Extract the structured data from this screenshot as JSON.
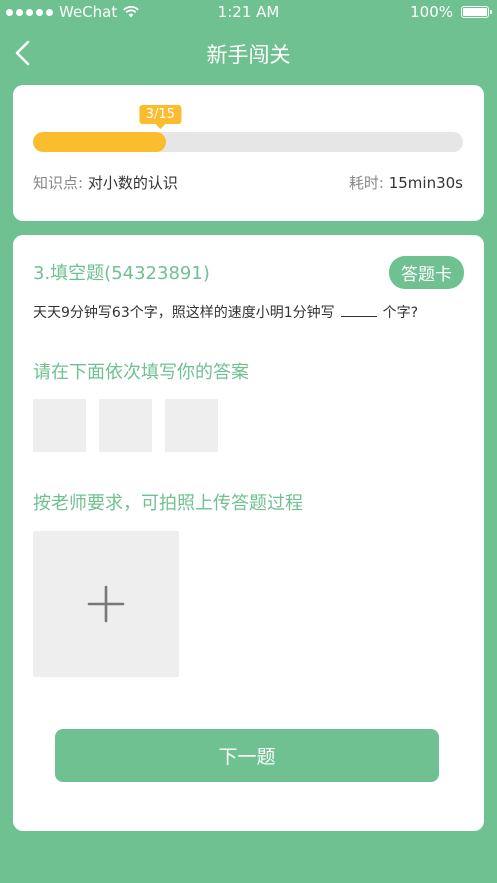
{
  "status_bar": {
    "carrier": "WeChat",
    "time": "1:21 AM",
    "battery": "100%"
  },
  "nav": {
    "title": "新手闯关"
  },
  "progress": {
    "badge": "3/15",
    "current": 3,
    "total": 15,
    "fill_percent": 31
  },
  "knowledge": {
    "label": "知识点:",
    "value": "对小数的认识"
  },
  "time_spent": {
    "label": "耗时:",
    "value": "15min30s"
  },
  "question": {
    "title": "3.填空题(54323891)",
    "answer_card_label": "答题卡",
    "text_before": "天天9分钟写63个字，照这样的速度小明1分钟写",
    "text_after": "个字?"
  },
  "answer_section": {
    "label": "请在下面依次填写你的答案"
  },
  "upload_section": {
    "label": "按老师要求，可拍照上传答题过程"
  },
  "next_button": {
    "label": "下一题"
  },
  "colors": {
    "primary": "#6fc191",
    "accent": "#fbbd2e"
  },
  "icons": [
    "back-icon",
    "wifi-icon",
    "battery-icon",
    "plus-icon"
  ]
}
